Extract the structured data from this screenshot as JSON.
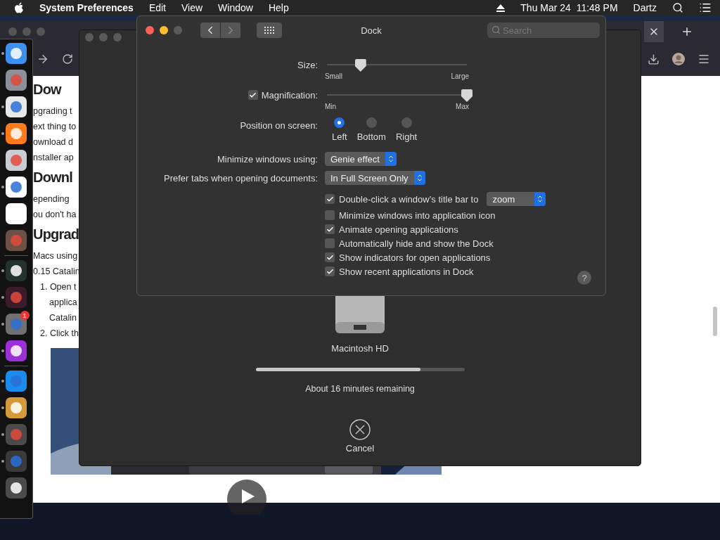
{
  "menu_bar": {
    "app": "System Preferences",
    "menus": [
      "Edit",
      "View",
      "Window",
      "Help"
    ],
    "clock": "Thu Mar 24  11:48 PM",
    "user": "Dartz"
  },
  "dock": {
    "items": [
      {
        "kind": "app",
        "running": true
      },
      {
        "kind": "app",
        "running": false
      },
      {
        "kind": "app",
        "running": true
      },
      {
        "kind": "app",
        "running": true
      },
      {
        "kind": "app",
        "running": false
      },
      {
        "kind": "app",
        "running": true
      },
      {
        "kind": "app",
        "running": false
      },
      {
        "kind": "app",
        "running": false
      },
      {
        "kind": "separator"
      },
      {
        "kind": "app",
        "running": true
      },
      {
        "kind": "app",
        "running": true
      },
      {
        "kind": "app",
        "running": true,
        "badge": "1"
      },
      {
        "kind": "app",
        "running": true
      },
      {
        "kind": "separator"
      },
      {
        "kind": "app",
        "running": true
      },
      {
        "kind": "app",
        "running": true
      },
      {
        "kind": "app",
        "running": true
      },
      {
        "kind": "app",
        "running": true
      },
      {
        "kind": "app",
        "running": false
      }
    ]
  },
  "browser": {
    "page": [
      {
        "kind": "heading",
        "text": "Dow"
      },
      {
        "kind": "line",
        "text": "pgrading t"
      },
      {
        "kind": "line",
        "text": "ext thing to"
      },
      {
        "kind": "line",
        "text": "ownload d"
      },
      {
        "kind": "line",
        "text": "nstaller ap"
      },
      {
        "kind": "heading",
        "text": "Downl"
      },
      {
        "kind": "line",
        "text": "epending"
      },
      {
        "kind": "line",
        "text": "ou don't ha"
      },
      {
        "kind": "heading",
        "text": "Upgrad"
      },
      {
        "kind": "line",
        "text": "Macs using"
      },
      {
        "kind": "line",
        "text": "0.15 Catalin"
      },
      {
        "kind": "list",
        "text": "1. Open t"
      },
      {
        "kind": "indent",
        "text": "applica"
      },
      {
        "kind": "indent",
        "text": "Catalin"
      },
      {
        "kind": "list",
        "text": "2. Click th"
      }
    ]
  },
  "installer": {
    "disk_label": "Macintosh HD",
    "progress": {
      "level": 0.79
    },
    "status": "About 16 minutes remaining",
    "cancel": "Cancel"
  },
  "prefs": {
    "title": "Dock",
    "search": {
      "placeholder": "Search"
    },
    "size": {
      "label": "Size:",
      "level": 0.24,
      "min": "Small",
      "max": "Large"
    },
    "magnification": {
      "label": "Magnification:",
      "checked": true,
      "level": 1.0,
      "min": "Min",
      "max": "Max"
    },
    "position": {
      "label": "Position on screen:",
      "options": [
        {
          "label": "Left",
          "selected": true
        },
        {
          "label": "Bottom",
          "selected": false
        },
        {
          "label": "Right",
          "selected": false
        }
      ]
    },
    "popups": [
      {
        "label": "Minimize windows using:",
        "value": "Genie effect"
      },
      {
        "label": "Prefer tabs when opening documents:",
        "value": "In Full Screen Only"
      }
    ],
    "checkboxes": [
      {
        "label": "Double-click a window’s title bar to",
        "checked": true,
        "popup": "zoom"
      },
      {
        "label": "Minimize windows into application icon",
        "checked": false
      },
      {
        "label": "Animate opening applications",
        "checked": true
      },
      {
        "label": "Automatically hide and show the Dock",
        "checked": false
      },
      {
        "label": "Show indicators for open applications",
        "checked": true
      },
      {
        "label": "Show recent applications in Dock",
        "checked": true
      }
    ],
    "help": "?"
  }
}
